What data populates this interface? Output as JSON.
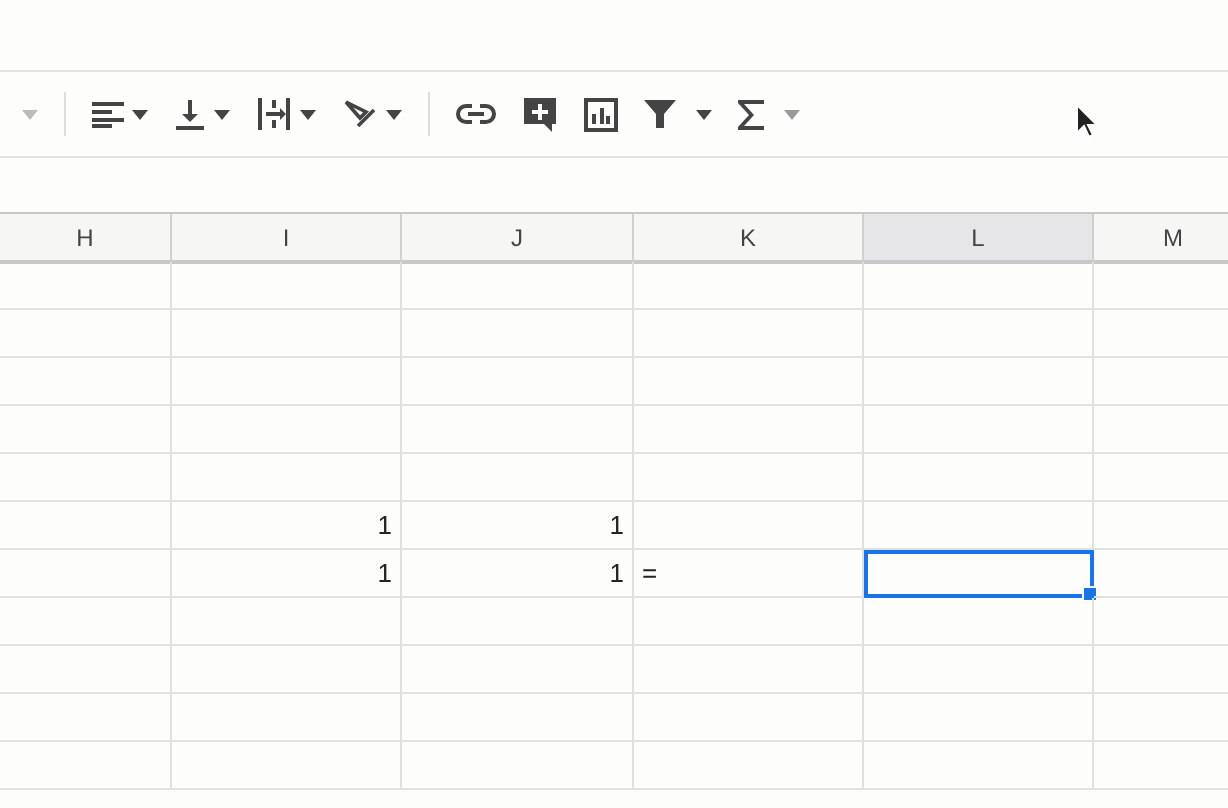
{
  "columns": [
    {
      "label": "H",
      "selected": false
    },
    {
      "label": "I",
      "selected": false
    },
    {
      "label": "J",
      "selected": false
    },
    {
      "label": "K",
      "selected": false
    },
    {
      "label": "L",
      "selected": true
    },
    {
      "label": "M",
      "selected": false
    }
  ],
  "rows": [
    {
      "selected": false
    },
    {
      "selected": false
    },
    {
      "selected": false
    },
    {
      "selected": false
    },
    {
      "selected": false
    },
    {
      "selected": false,
      "cells": [
        null,
        "1",
        "1"
      ]
    },
    {
      "selected": true,
      "cells": [
        null,
        "1",
        "1",
        "="
      ]
    },
    {
      "selected": false
    },
    {
      "selected": false
    },
    {
      "selected": false
    },
    {
      "selected": false
    }
  ]
}
